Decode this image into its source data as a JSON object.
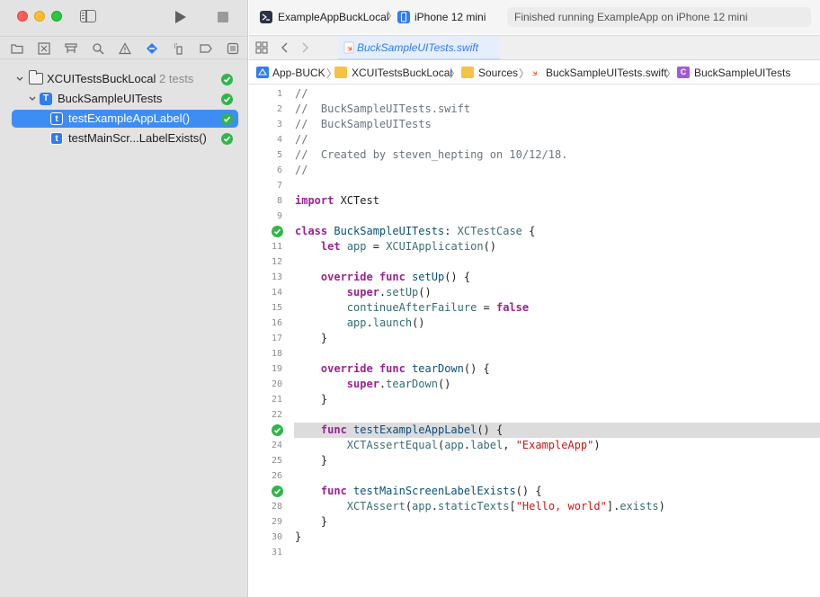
{
  "window": {
    "scheme_name": "ExampleAppBuckLocal",
    "destination": "iPhone 12 mini",
    "status": "Finished running ExampleApp on iPhone 12 mini"
  },
  "test_navigator": {
    "items": [
      {
        "label": "XCUITestsBuckLocal",
        "count": "2 tests"
      },
      {
        "label": "BuckSampleUITests"
      },
      {
        "label": "testExampleAppLabel()"
      },
      {
        "label": "testMainScr...LabelExists()"
      }
    ]
  },
  "tab": {
    "label": "BuckSampleUITests.swift"
  },
  "jump_bar": {
    "crumbs": [
      "App-BUCK",
      "XCUITestsBuckLocal",
      "Sources",
      "BuckSampleUITests.swift",
      "BuckSampleUITests"
    ]
  },
  "editor": {
    "current_line": 23,
    "passed_lines": [
      10,
      23,
      27
    ],
    "lines": [
      {
        "n": "1",
        "code": "//"
      },
      {
        "n": "2",
        "code": "//  BuckSampleUITests.swift"
      },
      {
        "n": "3",
        "code": "//  BuckSampleUITests"
      },
      {
        "n": "4",
        "code": "//"
      },
      {
        "n": "5",
        "code": "//  Created by steven_hepting on 10/12/18."
      },
      {
        "n": "6",
        "code": "//"
      },
      {
        "n": "7",
        "code": ""
      },
      {
        "n": "8",
        "code": "import XCTest"
      },
      {
        "n": "9",
        "code": ""
      },
      {
        "n": "10",
        "code": "class BuckSampleUITests: XCTestCase {"
      },
      {
        "n": "11",
        "code": "    let app = XCUIApplication()"
      },
      {
        "n": "12",
        "code": ""
      },
      {
        "n": "13",
        "code": "    override func setUp() {"
      },
      {
        "n": "14",
        "code": "        super.setUp()"
      },
      {
        "n": "15",
        "code": "        continueAfterFailure = false"
      },
      {
        "n": "16",
        "code": "        app.launch()"
      },
      {
        "n": "17",
        "code": "    }"
      },
      {
        "n": "18",
        "code": ""
      },
      {
        "n": "19",
        "code": "    override func tearDown() {"
      },
      {
        "n": "20",
        "code": "        super.tearDown()"
      },
      {
        "n": "21",
        "code": "    }"
      },
      {
        "n": "22",
        "code": ""
      },
      {
        "n": "23",
        "code": "    func testExampleAppLabel() {"
      },
      {
        "n": "24",
        "code": "        XCTAssertEqual(app.label, \"ExampleApp\")"
      },
      {
        "n": "25",
        "code": "    }"
      },
      {
        "n": "26",
        "code": ""
      },
      {
        "n": "27",
        "code": "    func testMainScreenLabelExists() {"
      },
      {
        "n": "28",
        "code": "        XCTAssert(app.staticTexts[\"Hello, world\"].exists)"
      },
      {
        "n": "29",
        "code": "    }"
      },
      {
        "n": "30",
        "code": "}"
      },
      {
        "n": "31",
        "code": ""
      }
    ]
  },
  "colors": {
    "accent": "#2f7cf6",
    "pass": "#2fb64a",
    "selection": "#3d8df5",
    "keyword": "#9b2393",
    "string": "#c41a16",
    "comment": "#6b7480"
  }
}
